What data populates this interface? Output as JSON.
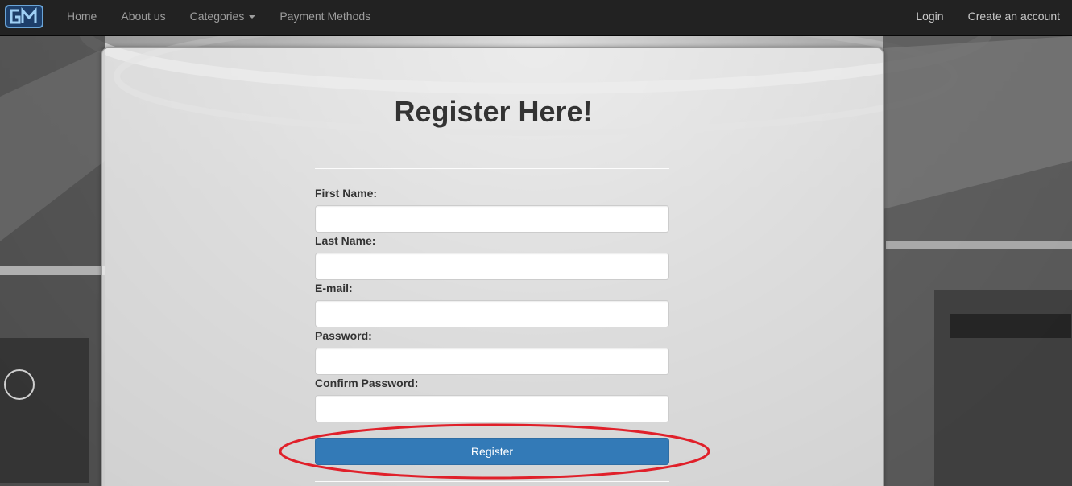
{
  "navbar": {
    "brand_icon": "gm-logo-icon",
    "left_items": [
      {
        "label": "Home"
      },
      {
        "label": "About us"
      },
      {
        "label": "Categories"
      },
      {
        "label": "Payment Methods"
      }
    ],
    "right_items": [
      {
        "label": "Login"
      },
      {
        "label": "Create an account"
      }
    ]
  },
  "form": {
    "title": "Register Here!",
    "fields": [
      {
        "label": "First Name:",
        "value": "",
        "placeholder": ""
      },
      {
        "label": "Last Name:",
        "value": "",
        "placeholder": ""
      },
      {
        "label": "E-mail:",
        "value": "",
        "placeholder": ""
      },
      {
        "label": "Password:",
        "value": "",
        "placeholder": ""
      },
      {
        "label": "Confirm Password:",
        "value": "",
        "placeholder": ""
      }
    ],
    "submit_label": "Register"
  },
  "colors": {
    "navbar_bg": "#222222",
    "primary_button": "#337ab7",
    "annotation_ellipse": "#e0202a"
  }
}
